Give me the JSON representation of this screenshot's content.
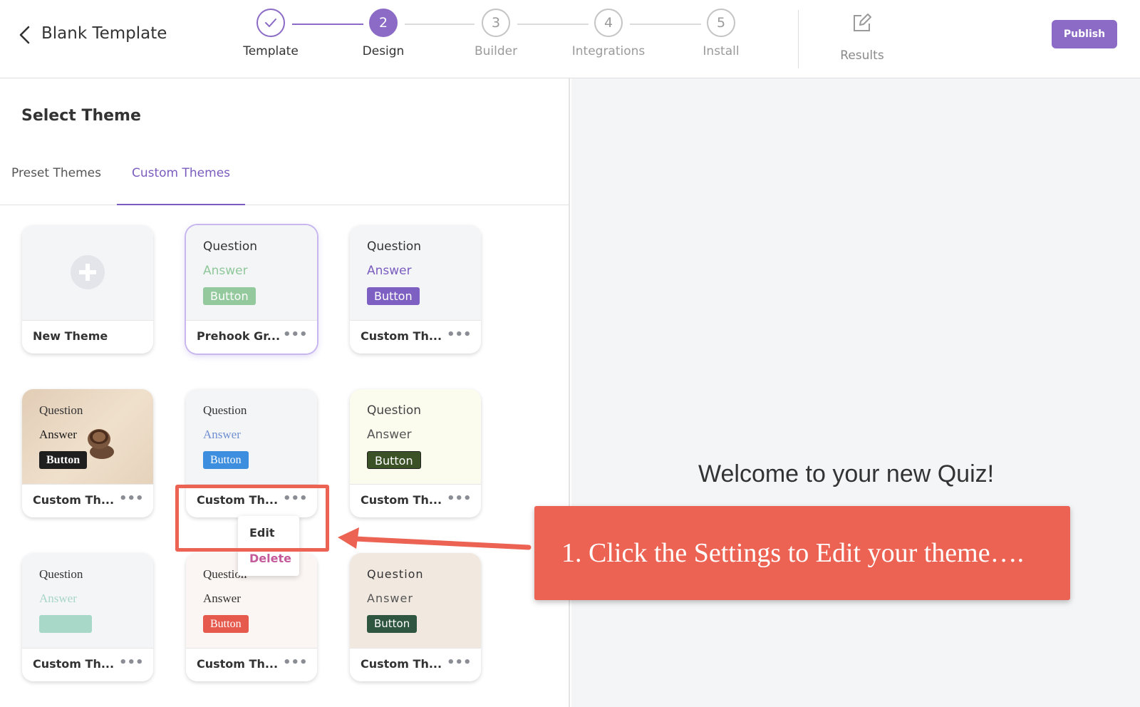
{
  "header": {
    "title": "Blank Template",
    "steps": [
      {
        "number": "",
        "label": "Template",
        "state": "done"
      },
      {
        "number": "2",
        "label": "Design",
        "state": "active"
      },
      {
        "number": "3",
        "label": "Builder",
        "state": "pending"
      },
      {
        "number": "4",
        "label": "Integrations",
        "state": "pending"
      },
      {
        "number": "5",
        "label": "Install",
        "state": "pending"
      }
    ],
    "results_label": "Results",
    "publish_label": "Publish"
  },
  "panel": {
    "title": "Select Theme",
    "tabs": [
      {
        "label": "Preset Themes",
        "active": false
      },
      {
        "label": "Custom Themes",
        "active": true
      }
    ]
  },
  "themes": [
    {
      "name": "New Theme",
      "kind": "new"
    },
    {
      "name": "Prehook Gr...",
      "question": "Question",
      "answer": "Answer",
      "button": "Button",
      "answer_color": "#8fc79a",
      "button_bg": "#93c99c",
      "selected": true
    },
    {
      "name": "Custom Th...",
      "question": "Question",
      "answer": "Answer",
      "button": "Button",
      "answer_color": "#7a5cbf",
      "button_bg": "#7e5fc2"
    },
    {
      "name": "Custom Th...",
      "question": "Question",
      "answer": "Answer",
      "button": "Button",
      "answer_color": "#1a1a1a",
      "button_bg": "#1f1f1f"
    },
    {
      "name": "Custom Th...",
      "question": "Question",
      "answer": "Answer",
      "button": "Button",
      "answer_color": "#6f8fd1",
      "button_bg": "#3d8ede"
    },
    {
      "name": "Custom Th...",
      "question": "Question",
      "answer": "Answer",
      "button": "Button",
      "answer_color": "#555555",
      "button_bg": "#3a5226"
    },
    {
      "name": "Custom Th...",
      "question": "Question",
      "answer": "Answer",
      "button": "",
      "answer_color": "#a7d6c5",
      "button_bg": "#a8d8c7"
    },
    {
      "name": "Custom Th...",
      "question": "Question",
      "answer": "Answer",
      "button": "Button",
      "answer_color": "#333333",
      "button_bg": "#e65a4e"
    },
    {
      "name": "Custom Th...",
      "question": "Question",
      "answer": "Answer",
      "button": "Button",
      "answer_color": "#555555",
      "button_bg": "#2f5640"
    }
  ],
  "context_menu": {
    "edit": "Edit",
    "delete": "Delete"
  },
  "preview": {
    "welcome": "Welcome to your new Quiz!"
  },
  "callout": {
    "text": "1. Click the Settings to Edit your theme…."
  },
  "colors": {
    "accent": "#8b6bc6",
    "callout": "#ec6353"
  }
}
